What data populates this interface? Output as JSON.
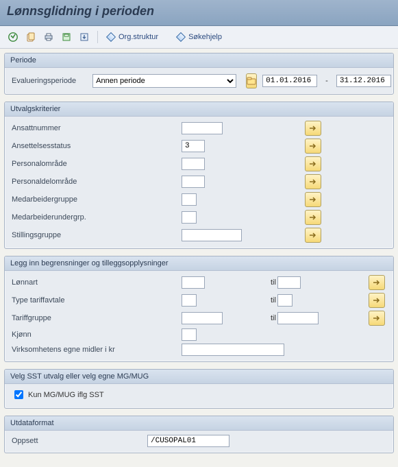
{
  "window": {
    "title": "Lønnsglidning i perioden"
  },
  "toolbar": {
    "execute": "Utfør",
    "export": "Eksporter",
    "print": "Skriv ut",
    "save_variant": "Lagre variant",
    "get_variant": "Hent variant",
    "org_structure": "Org.struktur",
    "search_help": "Søkehjelp"
  },
  "periode": {
    "header": "Periode",
    "label": "Evalueringsperiode",
    "selected": "Annen periode",
    "from": "01.01.2016",
    "to": "31.12.2016",
    "dash": "-"
  },
  "utvalg": {
    "header": "Utvalgskriterier",
    "ansattnummer": {
      "label": "Ansattnummer",
      "value": ""
    },
    "ansettelsesstatus": {
      "label": "Ansettelsesstatus",
      "value": "3"
    },
    "personalomrade": {
      "label": "Personalområde",
      "value": ""
    },
    "personaldelomrade": {
      "label": "Personaldelområde",
      "value": ""
    },
    "medarbeidergruppe": {
      "label": "Medarbeidergruppe",
      "value": ""
    },
    "medarbeiderundergrp": {
      "label": "Medarbeiderundergrp.",
      "value": ""
    },
    "stillingsgruppe": {
      "label": "Stillingsgruppe",
      "value": ""
    }
  },
  "limits": {
    "header": "Legg inn begrensninger og tilleggsopplysninger",
    "til": "til",
    "lonnart": {
      "label": "Lønnart",
      "from": "",
      "to": ""
    },
    "tariffavtale": {
      "label": "Type tariffavtale",
      "from": "",
      "to": ""
    },
    "tariffgruppe": {
      "label": "Tariffgruppe",
      "from": "",
      "to": ""
    },
    "kjonn": {
      "label": "Kjønn",
      "value": ""
    },
    "virksomhet": {
      "label": "Virksomhetens egne midler i kr",
      "value": ""
    }
  },
  "sst": {
    "header": "Velg SST utvalg eller velg egne MG/MUG",
    "checkbox_label": "Kun MG/MUG iflg SST",
    "checked": true
  },
  "utdata": {
    "header": "Utdataformat",
    "oppsett_label": "Oppsett",
    "oppsett_value": "/CUSOPAL01"
  }
}
